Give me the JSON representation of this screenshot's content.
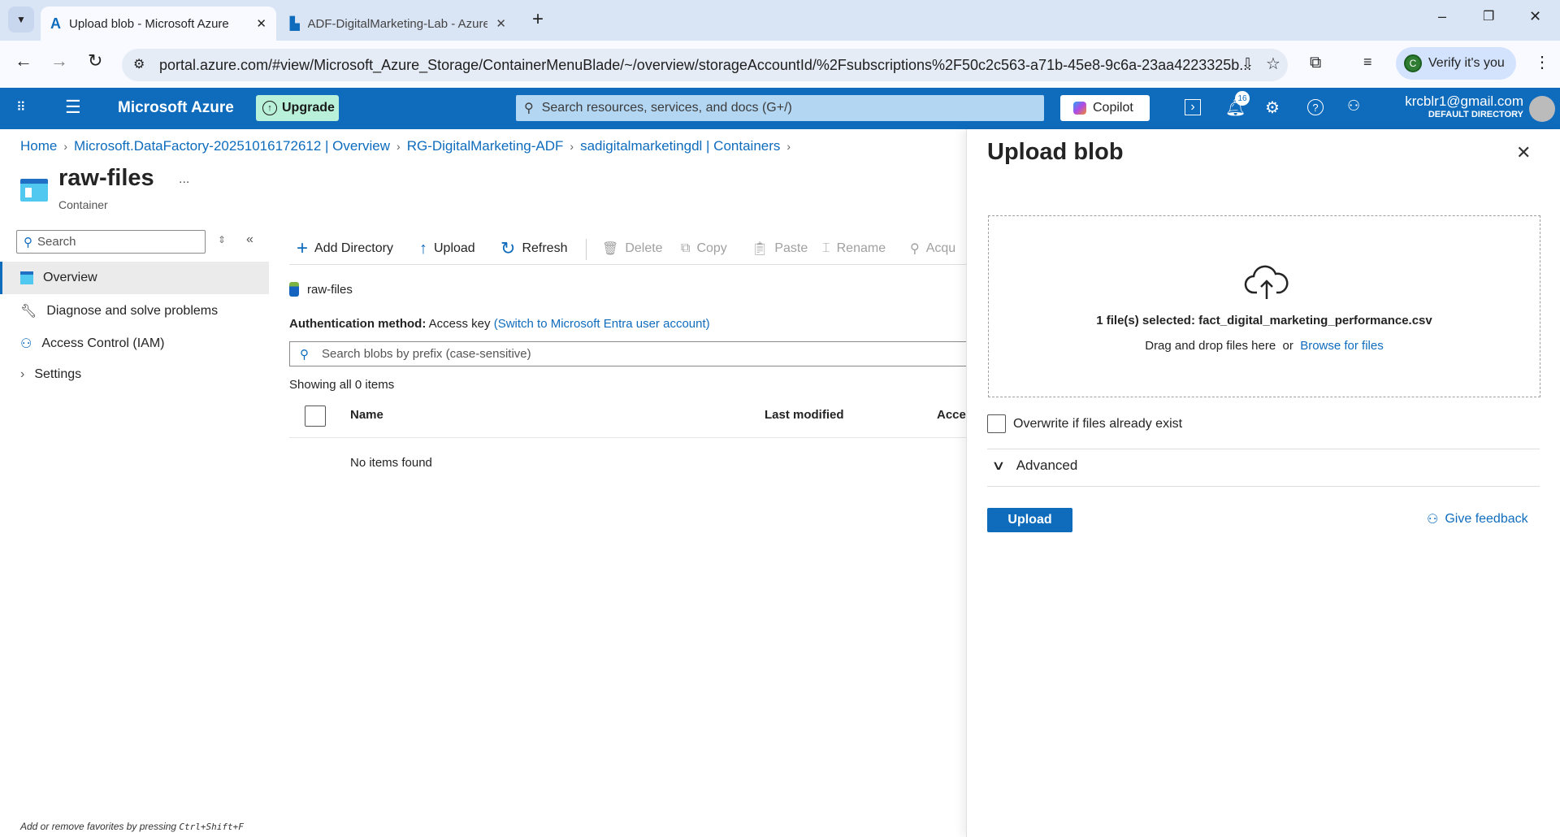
{
  "browser": {
    "tabs": [
      {
        "title": "Upload blob - Microsoft Azure",
        "active": true
      },
      {
        "title": "ADF-DigitalMarketing-Lab - Azure"
      }
    ],
    "url": "portal.azure.com/#view/Microsoft_Azure_Storage/ContainerMenuBlade/~/overview/storageAccountId/%2Fsubscriptions%2F50c2c563-a71b-45e8-9c6a-23aa4223325b...",
    "profile_label": "Verify it's you",
    "profile_initial": "C"
  },
  "azure_header": {
    "brand": "Microsoft Azure",
    "upgrade": "Upgrade",
    "search_placeholder": "Search resources, services, and docs (G+/)",
    "copilot": "Copilot",
    "notification_count": "16",
    "user_email": "krcblr1@gmail.com",
    "directory": "DEFAULT DIRECTORY"
  },
  "breadcrumb": [
    "Home",
    "Microsoft.DataFactory-20251016172612 | Overview",
    "RG-DigitalMarketing-ADF",
    "sadigitalmarketingdl | Containers"
  ],
  "resource": {
    "title": "raw-files",
    "subtitle": "Container",
    "more": "..."
  },
  "sidebar": {
    "search_placeholder": "Search",
    "items": [
      {
        "label": "Overview",
        "selected": true
      },
      {
        "label": "Diagnose and solve problems"
      },
      {
        "label": "Access Control (IAM)"
      },
      {
        "label": "Settings"
      }
    ],
    "footer_prefix": "Add or remove favorites by pressing ",
    "footer_keys": "Ctrl+Shift+F"
  },
  "toolbar": {
    "add_directory": "Add Directory",
    "upload": "Upload",
    "refresh": "Refresh",
    "delete": "Delete",
    "copy": "Copy",
    "paste": "Paste",
    "rename": "Rename",
    "acquire": "Acqu"
  },
  "content": {
    "path": "raw-files",
    "auth_label": "Authentication method:",
    "auth_value": "Access key",
    "auth_switch": "(Switch to Microsoft Entra user account)",
    "search_placeholder": "Search blobs by prefix (case-sensitive)",
    "showing": "Showing all 0 items",
    "columns": [
      "Name",
      "Last modified",
      "Acce"
    ],
    "empty": "No items found"
  },
  "upload_panel": {
    "title": "Upload blob",
    "selected": "1 file(s) selected: fact_digital_marketing_performance.csv",
    "drag_text": "Drag and drop files here",
    "or": "or",
    "browse": "Browse for files",
    "overwrite": "Overwrite if files already exist",
    "overwrite_checked": false,
    "advanced": "Advanced",
    "upload_button": "Upload",
    "feedback": "Give feedback"
  }
}
